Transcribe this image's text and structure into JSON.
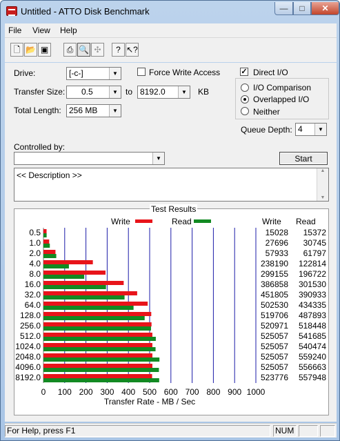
{
  "window": {
    "title": "Untitled - ATTO Disk Benchmark"
  },
  "menu": [
    "File",
    "View",
    "Help"
  ],
  "toolbar": {
    "icons": [
      "new-icon",
      "open-icon",
      "save-icon",
      "print-icon",
      "print-preview-icon",
      "move-icon",
      "help-icon",
      "context-help-icon"
    ]
  },
  "settings": {
    "drive_label": "Drive:",
    "drive_value": "[-c-]",
    "force_write_access_label": "Force Write Access",
    "force_write_access_checked": false,
    "direct_io_label": "Direct I/O",
    "direct_io_checked": true,
    "transfer_size_label": "Transfer Size:",
    "transfer_size_from": "0.5",
    "transfer_to_label": "to",
    "transfer_size_to": "8192.0",
    "transfer_unit": "KB",
    "total_length_label": "Total Length:",
    "total_length_value": "256 MB",
    "io_mode_options": [
      "I/O Comparison",
      "Overlapped I/O",
      "Neither"
    ],
    "io_mode_selected": "Overlapped I/O",
    "queue_depth_label": "Queue Depth:",
    "queue_depth_value": "4",
    "controlled_by_label": "Controlled by:",
    "controlled_by_value": "",
    "start_label": "Start",
    "description_text": "<< Description >>"
  },
  "colors": {
    "write": "#e8141a",
    "read": "#128a22",
    "gridline": "#1a1aa8"
  },
  "chart_data": {
    "type": "bar",
    "title": "Test Results",
    "xlabel": "Transfer Rate - MB / Sec",
    "xlim": [
      0,
      1000
    ],
    "xticks": [
      "0",
      "100",
      "200",
      "300",
      "400",
      "500",
      "600",
      "700",
      "800",
      "900",
      "1000"
    ],
    "categories": [
      "0.5",
      "1.0",
      "2.0",
      "4.0",
      "8.0",
      "16.0",
      "32.0",
      "64.0",
      "128.0",
      "256.0",
      "512.0",
      "1024.0",
      "2048.0",
      "4096.0",
      "8192.0"
    ],
    "series": [
      {
        "name": "Write",
        "values": [
          15028,
          27696,
          57933,
          238190,
          299155,
          386858,
          451805,
          502530,
          519706,
          520971,
          525057,
          525057,
          525057,
          525057,
          523776
        ]
      },
      {
        "name": "Read",
        "values": [
          15372,
          30745,
          61797,
          122814,
          196722,
          301530,
          390933,
          434335,
          487893,
          518448,
          541685,
          540474,
          559240,
          556663,
          557948
        ]
      }
    ],
    "column_headers": [
      "Write",
      "Read"
    ]
  },
  "status": {
    "help_text": "For Help, press F1",
    "num_indicator": "NUM"
  }
}
